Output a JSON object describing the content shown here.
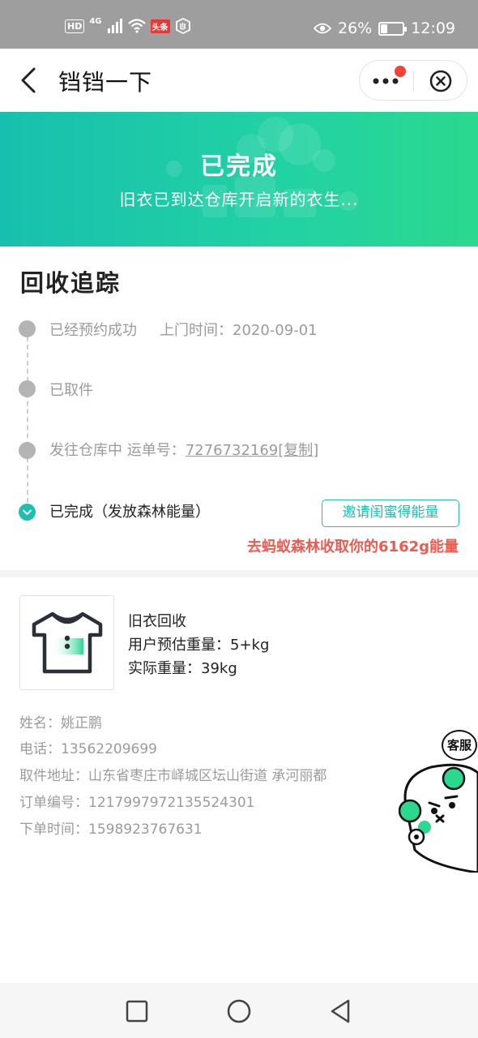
{
  "status_bar": {
    "hd": "HD",
    "network": "4G",
    "app_badge": "头条",
    "battery_percent_label": "26%",
    "battery_level": 0.26,
    "time": "12:09"
  },
  "nav": {
    "title": "铛铛一下"
  },
  "banner": {
    "status": "已完成",
    "subtitle": "旧衣已到达仓库开启新的衣生..."
  },
  "tracking": {
    "title": "回收追踪",
    "steps": [
      {
        "label": "已经预约成功",
        "extra": "上门时间：2020-09-01",
        "state": "done"
      },
      {
        "label": "已取件",
        "state": "done"
      },
      {
        "label": "发往仓库中 运单号：",
        "waybill": "7276732169",
        "copy": "[复制]",
        "state": "done"
      },
      {
        "label": "已完成（发放森林能量）",
        "state": "current"
      }
    ],
    "invite_button": "邀请闺蜜得能量",
    "energy_prefix": "去蚂蚁森林收取你的",
    "energy_amount": "6162g",
    "energy_suffix": "能量"
  },
  "product": {
    "name": "旧衣回收",
    "estimated_weight": "用户预估重量：5+kg",
    "actual_weight": "实际重量：39kg"
  },
  "info": {
    "name": "姓名：姚正鹏",
    "phone": "电话：13562209699",
    "address": "取件地址：山东省枣庄市峄城区坛山街道 承河丽都",
    "order_no": "订单编号：1217997972135524301",
    "order_time": "下单时间：1598923767631"
  },
  "customer_service": {
    "label": "客服"
  },
  "colors": {
    "accent": "#1fbfb0",
    "banner_start": "#17c0ae",
    "banner_end": "#2bd88f",
    "energy_text": "#ef5a50"
  },
  "icons": {
    "back": "chevron-left-icon",
    "more": "more-dots-icon",
    "close": "close-circle-icon",
    "check": "check-circle-icon",
    "shirt": "tshirt-icon"
  }
}
